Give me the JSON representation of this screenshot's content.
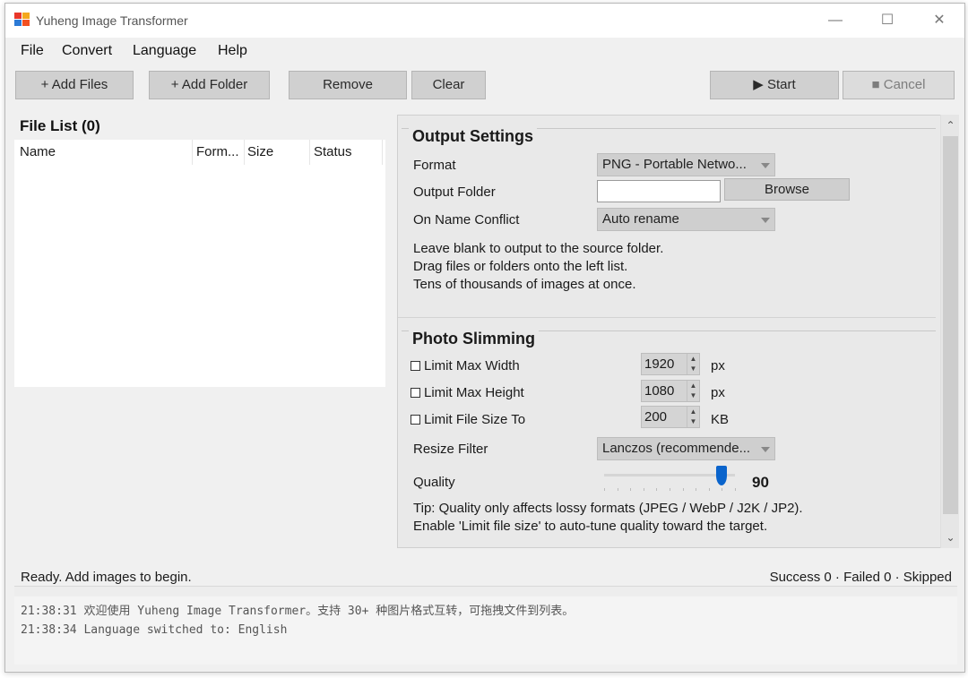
{
  "window": {
    "title": "Yuheng Image Transformer"
  },
  "menu": [
    "File",
    "Convert",
    "Language",
    "Help"
  ],
  "toolbar": {
    "add_files": "+ Add Files",
    "add_folder": "+ Add Folder",
    "remove": "Remove",
    "clear": "Clear",
    "start": "▶ Start",
    "cancel": "■ Cancel"
  },
  "file_list": {
    "title": "File List (0)",
    "columns": [
      "Name",
      "Form...",
      "Size",
      "Status"
    ]
  },
  "output_settings": {
    "title": "Output Settings",
    "format_label": "Format",
    "format_value": "PNG - Portable Netwo...",
    "folder_label": "Output Folder",
    "folder_value": "",
    "browse": "Browse",
    "conflict_label": "On Name Conflict",
    "conflict_value": "Auto rename",
    "help": [
      "Leave blank to output to the source folder.",
      "Drag files or folders onto the left list.",
      "Tens of thousands of images at once."
    ]
  },
  "photo_slimming": {
    "title": "Photo Slimming",
    "max_width_label": "Limit Max Width",
    "max_width_value": "1920",
    "max_width_unit": "px",
    "max_height_label": "Limit Max Height",
    "max_height_value": "1080",
    "max_height_unit": "px",
    "file_size_label": "Limit File Size To",
    "file_size_value": "200",
    "file_size_unit": "KB",
    "resize_label": "Resize Filter",
    "resize_value": "Lanczos (recommende...",
    "quality_label": "Quality",
    "quality_value": "90",
    "quality_level": 0.9,
    "tip": [
      "Tip: Quality only affects lossy formats (JPEG / WebP / J2K / JP2).",
      "Enable 'Limit file size' to auto-tune quality toward the target."
    ]
  },
  "status": {
    "left": "Ready. Add images to begin.",
    "right": "Success 0 · Failed 0 · Skipped"
  },
  "log": [
    "21:38:31  欢迎使用 Yuheng Image Transformer。支持 30+ 种图片格式互转，可拖拽文件到列表。",
    "21:38:34  Language switched to: English"
  ],
  "colors": {
    "accent": "#0a64cc",
    "button": "#d0d0d0",
    "panel": "#e9e9e9"
  }
}
